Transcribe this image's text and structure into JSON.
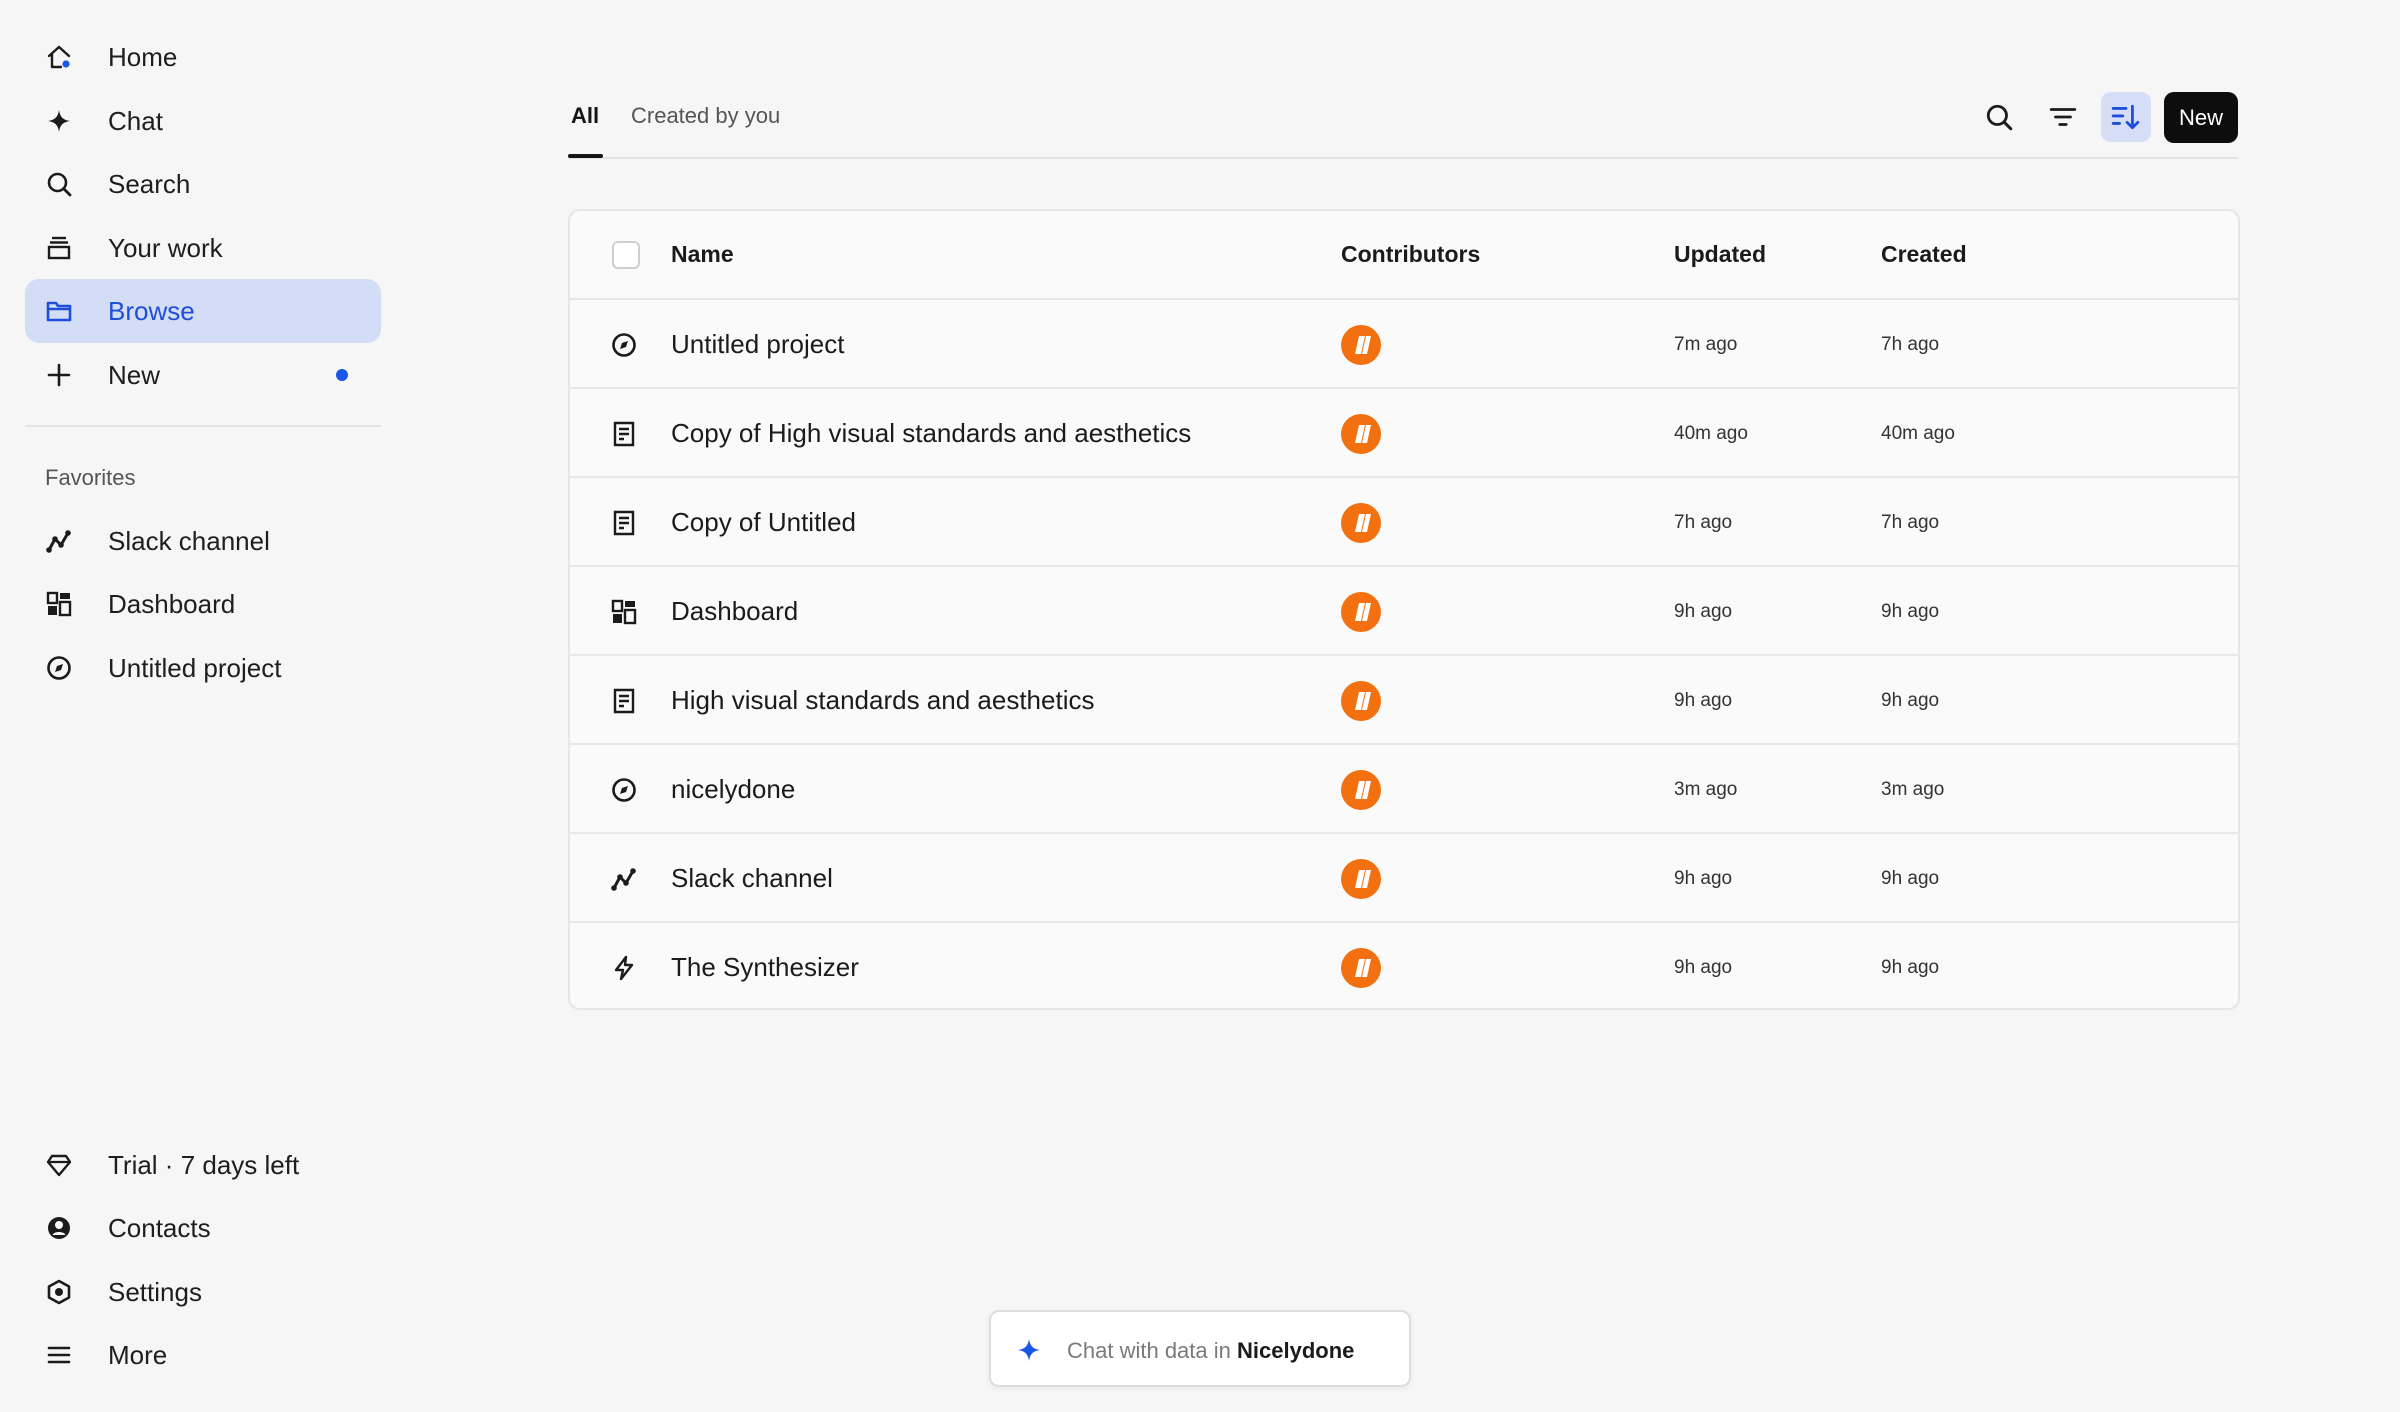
{
  "sidebar": {
    "nav": [
      {
        "label": "Home",
        "icon": "home-icon"
      },
      {
        "label": "Chat",
        "icon": "sparkle-icon"
      },
      {
        "label": "Search",
        "icon": "search-icon"
      },
      {
        "label": "Your work",
        "icon": "stack-icon"
      },
      {
        "label": "Browse",
        "icon": "folder-icon",
        "active": true
      },
      {
        "label": "New",
        "icon": "plus-icon",
        "has_dot": true
      }
    ],
    "favorites_title": "Favorites",
    "favorites": [
      {
        "label": "Slack channel",
        "icon": "line-chart-icon"
      },
      {
        "label": "Dashboard",
        "icon": "dashboard-icon"
      },
      {
        "label": "Untitled project",
        "icon": "compass-icon"
      }
    ],
    "bottom": [
      {
        "label": "Trial · 7 days left",
        "icon": "diamond-icon"
      },
      {
        "label": "Contacts",
        "icon": "contact-icon"
      },
      {
        "label": "Settings",
        "icon": "settings-hex-icon"
      },
      {
        "label": "More",
        "icon": "menu-icon"
      }
    ]
  },
  "tabs": [
    {
      "label": "All",
      "active": true
    },
    {
      "label": "Created by you",
      "active": false
    }
  ],
  "toolbar": {
    "new_label": "New"
  },
  "table": {
    "columns": {
      "name": "Name",
      "contributors": "Contributors",
      "updated": "Updated",
      "created": "Created"
    },
    "rows": [
      {
        "name": "Untitled project",
        "icon": "compass-icon",
        "updated": "7m ago",
        "created": "7h ago"
      },
      {
        "name": "Copy of High visual standards and aesthetics",
        "icon": "document-icon",
        "updated": "40m ago",
        "created": "40m ago"
      },
      {
        "name": "Copy of Untitled",
        "icon": "document-icon",
        "updated": "7h ago",
        "created": "7h ago"
      },
      {
        "name": "Dashboard",
        "icon": "dashboard-icon",
        "updated": "9h ago",
        "created": "9h ago"
      },
      {
        "name": "High visual standards and aesthetics",
        "icon": "document-icon",
        "updated": "9h ago",
        "created": "9h ago"
      },
      {
        "name": "nicelydone",
        "icon": "compass-icon",
        "updated": "3m ago",
        "created": "3m ago"
      },
      {
        "name": "Slack channel",
        "icon": "line-chart-icon",
        "updated": "9h ago",
        "created": "9h ago"
      },
      {
        "name": "The Synthesizer",
        "icon": "lightning-icon",
        "updated": "9h ago",
        "created": "9h ago"
      }
    ]
  },
  "chat_pill": {
    "prefix": "Chat with data in",
    "workspace": "Nicelydone"
  },
  "colors": {
    "accent": "#1f4fd8",
    "active_bg": "#d3ddf6",
    "avatar": "#f2700f",
    "primary_button": "#0d0d0d"
  }
}
